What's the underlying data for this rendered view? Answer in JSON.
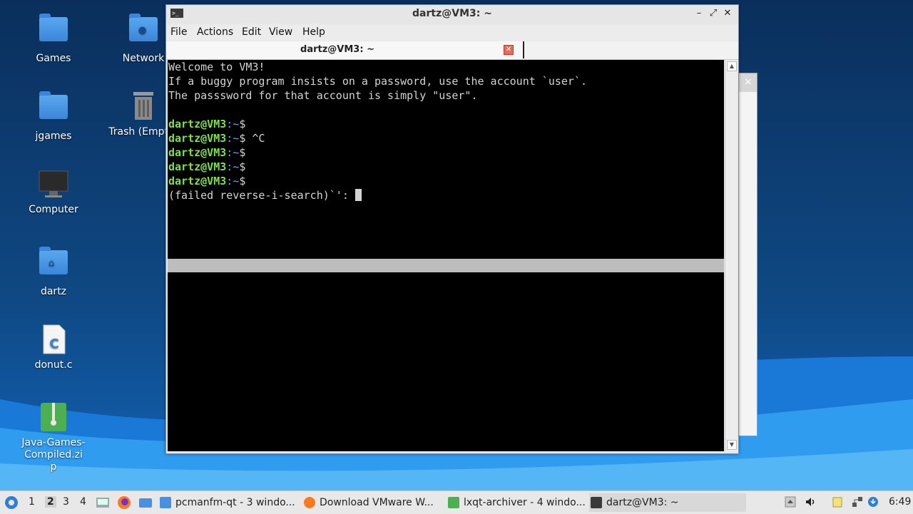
{
  "desktop": {
    "icons": [
      {
        "label": "Games"
      },
      {
        "label": "Network"
      },
      {
        "label": "jgames"
      },
      {
        "label": "Trash (Empty)"
      },
      {
        "label": "Computer"
      },
      {
        "label": "dartz"
      },
      {
        "label": "donut.c"
      },
      {
        "label": "Java-Games-Compiled.zip"
      }
    ]
  },
  "window": {
    "title": "dartz@VM3: ~",
    "menu": [
      "File",
      "Actions",
      "Edit",
      "View",
      "Help"
    ],
    "tab_label": "dartz@VM3: ~"
  },
  "terminal": {
    "welcome": [
      "Welcome to VM3!",
      "If a buggy program insists on a password, use the account `user`.",
      "The passsword for that account is simply \"user\"."
    ],
    "prompt_user": "dartz@VM3",
    "prompt_path": ":~",
    "prompt_symbol": "$",
    "commands": [
      "",
      " ^C",
      "",
      "",
      ""
    ],
    "search_line": "(failed reverse-i-search)`': "
  },
  "taskbar": {
    "desktops": [
      "1",
      "2",
      "3",
      "4"
    ],
    "tasks": [
      {
        "label": "pcmanfm-qt - 3 windo..."
      },
      {
        "label": "Download VMware W..."
      },
      {
        "label": "lxqt-archiver - 4 windo..."
      },
      {
        "label": "dartz@VM3: ~"
      }
    ],
    "clock": "6:49"
  },
  "colors": {
    "prompt_user": "#7ee04a",
    "prompt_path": "#6aa7e8",
    "terminal_bg": "#000000"
  }
}
